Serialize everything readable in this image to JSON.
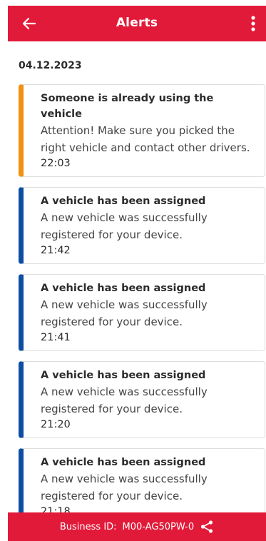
{
  "header": {
    "title": "Alerts",
    "back_icon": "arrow-left-icon",
    "menu_icon": "more-vertical-icon",
    "background": "#e21a39"
  },
  "date_group": "04.12.2023",
  "alerts": [
    {
      "title": "Someone is already using the vehicle",
      "message": "Attention! Make sure you picked the right vehicle and contact other drivers.",
      "time": "22:03",
      "type": "warning",
      "accent": "#f29010"
    },
    {
      "title": "A vehicle has been assigned",
      "message": "A new vehicle was successfully registered for your device.",
      "time": "21:42",
      "type": "info",
      "accent": "#0c4ea2"
    },
    {
      "title": "A vehicle has been assigned",
      "message": "A new vehicle was successfully registered for your device.",
      "time": "21:41",
      "type": "info",
      "accent": "#0c4ea2"
    },
    {
      "title": "A vehicle has been assigned",
      "message": "A new vehicle was successfully registered for your device.",
      "time": "21:20",
      "type": "info",
      "accent": "#0c4ea2"
    },
    {
      "title": "A vehicle has been assigned",
      "message": "A new vehicle was successfully registered for your device.",
      "time": "21:18",
      "type": "info",
      "accent": "#0c4ea2"
    }
  ],
  "footer": {
    "business_id_label": "Business ID:",
    "business_id_value": "M00-AG50PW-0",
    "share_icon": "share-icon"
  }
}
